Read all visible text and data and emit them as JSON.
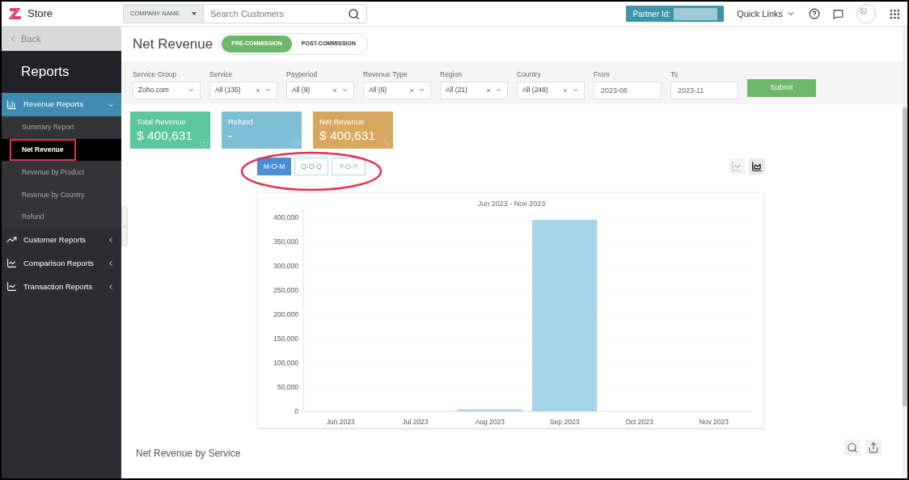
{
  "header": {
    "app_name": "Store",
    "search": {
      "scope": "COMPANY NAME",
      "placeholder": "Search Customers"
    },
    "partner_label": "Partner Id:",
    "quick_links": "Quick Links"
  },
  "sidebar": {
    "back": "Back",
    "title": "Reports",
    "groups": [
      {
        "label": "Revenue Reports",
        "kind": "revenue",
        "expanded": true,
        "children": [
          {
            "label": "Summary Report",
            "selected": false
          },
          {
            "label": "Net Revenue",
            "selected": true
          },
          {
            "label": "Revenue by Product",
            "selected": false
          },
          {
            "label": "Revenue by Country",
            "selected": false
          },
          {
            "label": "Refund",
            "selected": false
          }
        ]
      },
      {
        "label": "Customer Reports",
        "kind": "customer",
        "expanded": false
      },
      {
        "label": "Comparison Reports",
        "kind": "comparison",
        "expanded": false
      },
      {
        "label": "Transaction Reports",
        "kind": "transaction",
        "expanded": false
      }
    ]
  },
  "page": {
    "title": "Net Revenue",
    "modes": [
      {
        "label": "PRE-COMMISSION",
        "selected": true
      },
      {
        "label": "POST-COMMISSION",
        "selected": false
      }
    ]
  },
  "filters": [
    {
      "label": "Service Group",
      "kind": "select",
      "value": "Zoho.com",
      "clearable": false
    },
    {
      "label": "Service",
      "kind": "select",
      "value": "All (135)",
      "clearable": true
    },
    {
      "label": "Payperiod",
      "kind": "select",
      "value": "All (9)",
      "clearable": true
    },
    {
      "label": "Revenue Type",
      "kind": "select",
      "value": "All (6)",
      "clearable": true
    },
    {
      "label": "Region",
      "kind": "select",
      "value": "All (21)",
      "clearable": true
    },
    {
      "label": "Country",
      "kind": "select",
      "value": "All (248)",
      "clearable": true
    },
    {
      "label": "From",
      "kind": "date",
      "value": "2023-06"
    },
    {
      "label": "To",
      "kind": "date",
      "value": "2023-11"
    }
  ],
  "submit": "Submit",
  "cards": [
    {
      "label": "Total Revenue",
      "value": "$ 400,631",
      "kind": "total",
      "color": "#5cc79a"
    },
    {
      "label": "Refund",
      "value": "-",
      "kind": "refund",
      "color": "#7fbfd6"
    },
    {
      "label": "Net Revenue",
      "value": "$ 400,631",
      "kind": "net",
      "color": "#d9a860"
    }
  ],
  "periods": [
    {
      "label": "M-O-M",
      "selected": true
    },
    {
      "label": "Q-O-Q",
      "selected": false
    },
    {
      "label": "Y-O-Y",
      "selected": false
    }
  ],
  "chart_types": [
    {
      "kind": "line",
      "selected": false
    },
    {
      "kind": "bar",
      "selected": true
    }
  ],
  "chart": {
    "chart_data": {
      "type": "bar",
      "grid": true,
      "title": "Jun 2023 - Nov 2023",
      "categories": [
        "Jun 2023",
        "Jul 2023",
        "Aug 2023",
        "Sep 2023",
        "Oct 2023",
        "Nov 2023"
      ],
      "values": [
        0,
        0,
        4000,
        395000,
        0,
        0
      ],
      "ylim": [
        0,
        400000
      ],
      "yticks": [
        {
          "value": 0,
          "label": "0"
        },
        {
          "value": 50000,
          "label": "50,000"
        },
        {
          "value": 100000,
          "label": "100,000"
        },
        {
          "value": 150000,
          "label": "150,000"
        },
        {
          "value": 200000,
          "label": "200,000"
        },
        {
          "value": 250000,
          "label": "250,000"
        },
        {
          "value": 300000,
          "label": "300,000"
        },
        {
          "value": 350000,
          "label": "350,000"
        },
        {
          "value": 400000,
          "label": "400,000"
        }
      ]
    }
  },
  "section_title": "Net Revenue by Service"
}
